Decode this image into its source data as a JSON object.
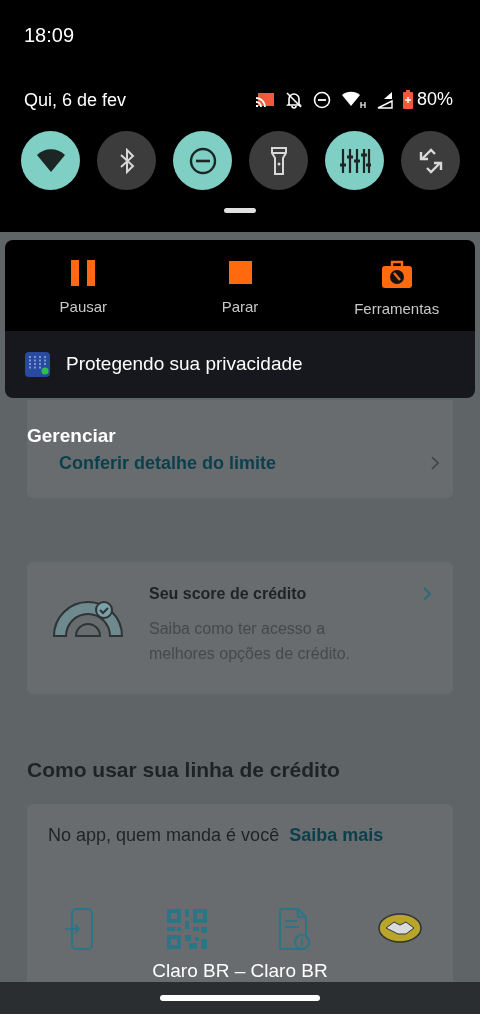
{
  "status_bar": {
    "time": "18:09",
    "date": "Qui, 6 de fev",
    "battery": "80%"
  },
  "quick_settings": [
    {
      "kind": "wifi",
      "on": true
    },
    {
      "kind": "bluetooth",
      "on": false
    },
    {
      "kind": "dnd",
      "on": true
    },
    {
      "kind": "flashlight",
      "on": false
    },
    {
      "kind": "equalizer",
      "on": true
    },
    {
      "kind": "rotate",
      "on": false
    }
  ],
  "notification": {
    "actions": [
      {
        "kind": "pause",
        "label": "Pausar"
      },
      {
        "kind": "stop",
        "label": "Parar"
      },
      {
        "kind": "tools",
        "label": "Ferramentas"
      }
    ],
    "message": "Protegendo sua privacidade"
  },
  "app": {
    "manage_label": "Gerenciar",
    "limit_link": "Conferir detalhe do limite",
    "score_card": {
      "title": "Seu score de crédito",
      "description": "Saiba como ter acesso a melhores opções de crédito."
    },
    "section_title": "Como usar sua linha de crédito",
    "usage_card": {
      "text": "No app, quem manda é você",
      "link": "Saiba mais"
    }
  },
  "carrier": "Claro BR – Claro BR"
}
